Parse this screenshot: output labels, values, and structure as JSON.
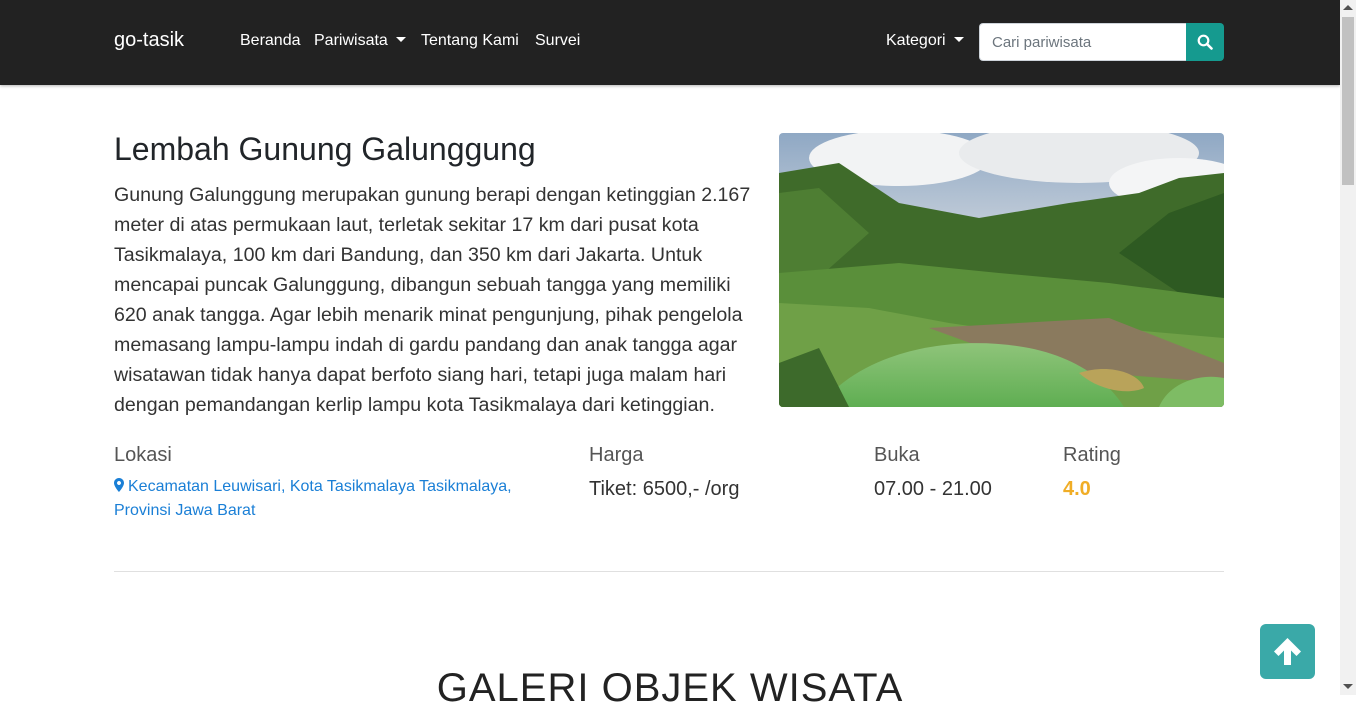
{
  "navbar": {
    "brand": "go-tasik",
    "links": [
      {
        "label": "Beranda"
      },
      {
        "label": "Pariwisata",
        "dropdown": true
      },
      {
        "label": "Tentang Kami"
      },
      {
        "label": "Survei"
      }
    ],
    "category": {
      "label": "Kategori",
      "dropdown": true
    },
    "search": {
      "placeholder": "Cari pariwisata",
      "value": "",
      "icon": "search-icon"
    }
  },
  "attraction": {
    "title": "Lembah Gunung Galunggung",
    "description": "Gunung Galunggung merupakan gunung berapi dengan ketinggian 2.167 meter di atas permukaan laut, terletak sekitar 17 km dari pusat kota Tasikmalaya, 100 km dari Bandung, dan 350 km dari Jakarta. Untuk mencapai puncak Galunggung, dibangun sebuah tangga yang memiliki 620 anak tangga. Agar lebih menarik minat pengunjung, pihak pengelola memasang lampu-lampu indah di gardu pandang dan anak tangga agar wisatawan tidak hanya dapat berfoto siang hari, tetapi juga malam hari dengan pemandangan kerlip lampu kota Tasikmalaya dari ketinggian.",
    "info": {
      "location": {
        "label": "Lokasi",
        "value": "Kecamatan Leuwisari, Kota Tasikmalaya Tasikmalaya, Provinsi Jawa Barat",
        "icon": "map-marker-icon"
      },
      "price": {
        "label": "Harga",
        "value": "Tiket: 6500,- /org"
      },
      "hours": {
        "label": "Buka",
        "value": "07.00 - 21.00"
      },
      "rating": {
        "label": "Rating",
        "value": "4.0"
      }
    }
  },
  "gallery": {
    "title": "GALERI OBJEK WISATA"
  },
  "back_to_top": {
    "icon": "arrow-up-icon"
  },
  "colors": {
    "navbar_bg": "#222222",
    "search_button": "#159a8f",
    "link": "#1a7fd6",
    "rating": "#f0ad26",
    "back_to_top": "#3aa9a8"
  }
}
